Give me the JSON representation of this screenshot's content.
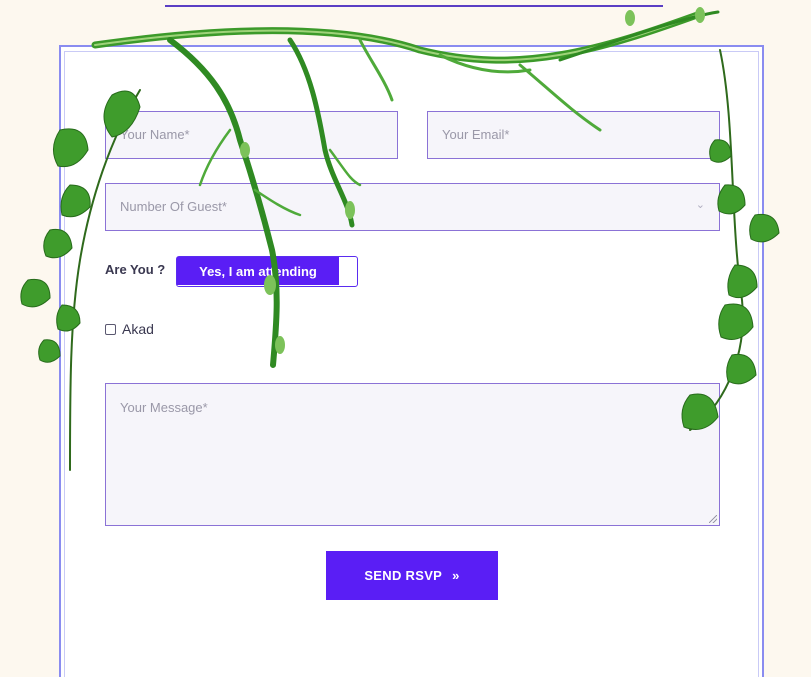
{
  "form": {
    "name_placeholder": "Your Name*",
    "email_placeholder": "Your Email*",
    "guest_placeholder": "Number Of Guest*",
    "attendance_label": "Are You ?",
    "attendance_value": "Yes, I am attending",
    "akad_label": "Akad",
    "message_placeholder": "Your Message*",
    "submit_label": "SEND RSVP",
    "submit_icon": "»"
  },
  "colors": {
    "accent": "#5a1ef5",
    "field_border": "#8b72d6",
    "field_bg": "#f6f5fa",
    "card_border": "#8a8cf0",
    "page_bg": "#fdf8ef",
    "vine_green": "#3c9a2a"
  }
}
